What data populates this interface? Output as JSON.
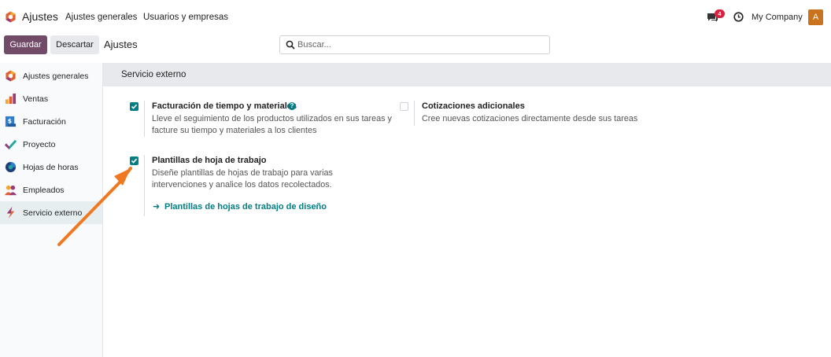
{
  "navbar": {
    "app_title": "Ajustes",
    "menu": [
      "Ajustes generales",
      "Usuarios y empresas"
    ],
    "chat_count": "4",
    "company": "My Company",
    "avatar_letter": "A"
  },
  "control_panel": {
    "save_label": "Guardar",
    "discard_label": "Descartar",
    "breadcrumb": "Ajustes",
    "search_placeholder": "Buscar..."
  },
  "sidebar": {
    "items": [
      {
        "label": "Ajustes generales",
        "icon": "odoo-logo-icon"
      },
      {
        "label": "Ventas",
        "icon": "sales-chart-icon"
      },
      {
        "label": "Facturación",
        "icon": "invoicing-icon"
      },
      {
        "label": "Proyecto",
        "icon": "project-check-icon"
      },
      {
        "label": "Hojas de horas",
        "icon": "timesheet-icon"
      },
      {
        "label": "Empleados",
        "icon": "employees-icon"
      },
      {
        "label": "Servicio externo",
        "icon": "field-service-icon",
        "active": true
      }
    ]
  },
  "section": {
    "title": "Servicio externo",
    "settings": [
      {
        "title": "Facturación de tiempo y materiales",
        "description": "Lleve el seguimiento de los productos utilizados en sus tareas y facture su tiempo y materiales a los clientes",
        "checked": true,
        "help": true
      },
      {
        "title": "Cotizaciones adicionales",
        "description": "Cree nuevas cotizaciones directamente desde sus tareas",
        "checked": false
      },
      {
        "title": "Plantillas de hoja de trabajo",
        "description": "Diseñe plantillas de hojas de trabajo para varias intervenciones y analice los datos recolectados.",
        "checked": true,
        "link": "Plantillas de hojas de trabajo de diseño"
      }
    ]
  },
  "colors": {
    "primary": "#714b67",
    "accent": "#017e84",
    "badge": "#d9223f",
    "avatar": "#c9731e",
    "annotation_arrow": "#f07820"
  }
}
